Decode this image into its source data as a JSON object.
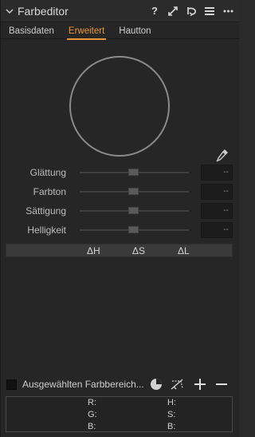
{
  "header": {
    "title": "Farbeditor"
  },
  "tabs": [
    {
      "label": "Basisdaten",
      "active": false
    },
    {
      "label": "Erweitert",
      "active": true
    },
    {
      "label": "Hautton",
      "active": false
    }
  ],
  "sliders": [
    {
      "label": "Glättung",
      "value": "--"
    },
    {
      "label": "Farbton",
      "value": "--"
    },
    {
      "label": "Sättigung",
      "value": "--"
    },
    {
      "label": "Helligkeit",
      "value": "--"
    }
  ],
  "delta": {
    "h": "ΔH",
    "s": "ΔS",
    "l": "ΔL"
  },
  "selection": {
    "label": "Ausgewählten Farbbereich..."
  },
  "readout": {
    "r": "R:",
    "g": "G:",
    "b": "B:",
    "h": "H:",
    "s": "S:",
    "b2": "B:"
  },
  "colors": {
    "accent": "#e8973a",
    "panel": "#262626"
  }
}
